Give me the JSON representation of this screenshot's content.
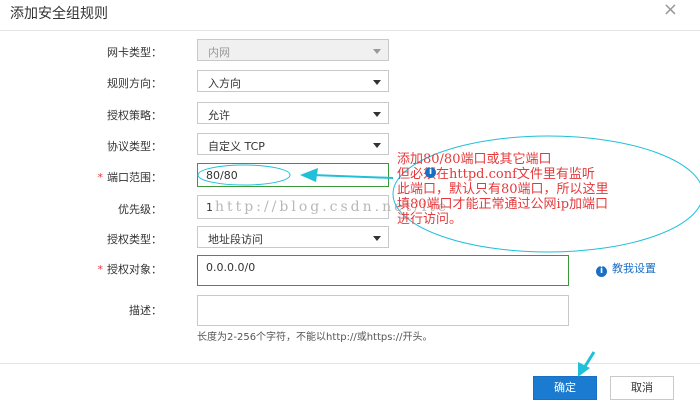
{
  "dialog": {
    "title": "添加安全组规则",
    "close_icon": "close-icon"
  },
  "form": {
    "nic_type": {
      "label": "网卡类型：",
      "value": "内网"
    },
    "direction": {
      "label": "规则方向：",
      "value": "入方向"
    },
    "policy": {
      "label": "授权策略：",
      "value": "允许"
    },
    "protocol": {
      "label": "协议类型：",
      "value": "自定义 TCP"
    },
    "port_range": {
      "required_mark": "*",
      "label": "端口范围：",
      "value": "80/80"
    },
    "priority": {
      "label": "优先级：",
      "value": "1"
    },
    "auth_type": {
      "label": "授权类型：",
      "value": "地址段访问"
    },
    "auth_object": {
      "required_mark": "*",
      "label": "授权对象：",
      "value": "0.0.0.0/0"
    },
    "description": {
      "label": "描述：",
      "value": "",
      "hint": "长度为2-256个字符，不能以http://或https://开头。"
    },
    "help_link": "教我设置"
  },
  "watermark": "http://blog.csdn.net/ite",
  "annotation": {
    "lines": [
      "添加80/80端口或其它端口",
      "但必须在httpd.conf文件里有监听",
      "此端口，默认只有80端口，所以这里",
      "填80端口才能正常通过公网ip加端口",
      "进行访问。"
    ]
  },
  "buttons": {
    "ok": "确定",
    "cancel": "取消"
  },
  "colors": {
    "primary": "#1a7bd0",
    "annotation_red": "#e4393c",
    "highlight_green": "#3a9a3a",
    "callout_cyan": "#20c0d8"
  }
}
